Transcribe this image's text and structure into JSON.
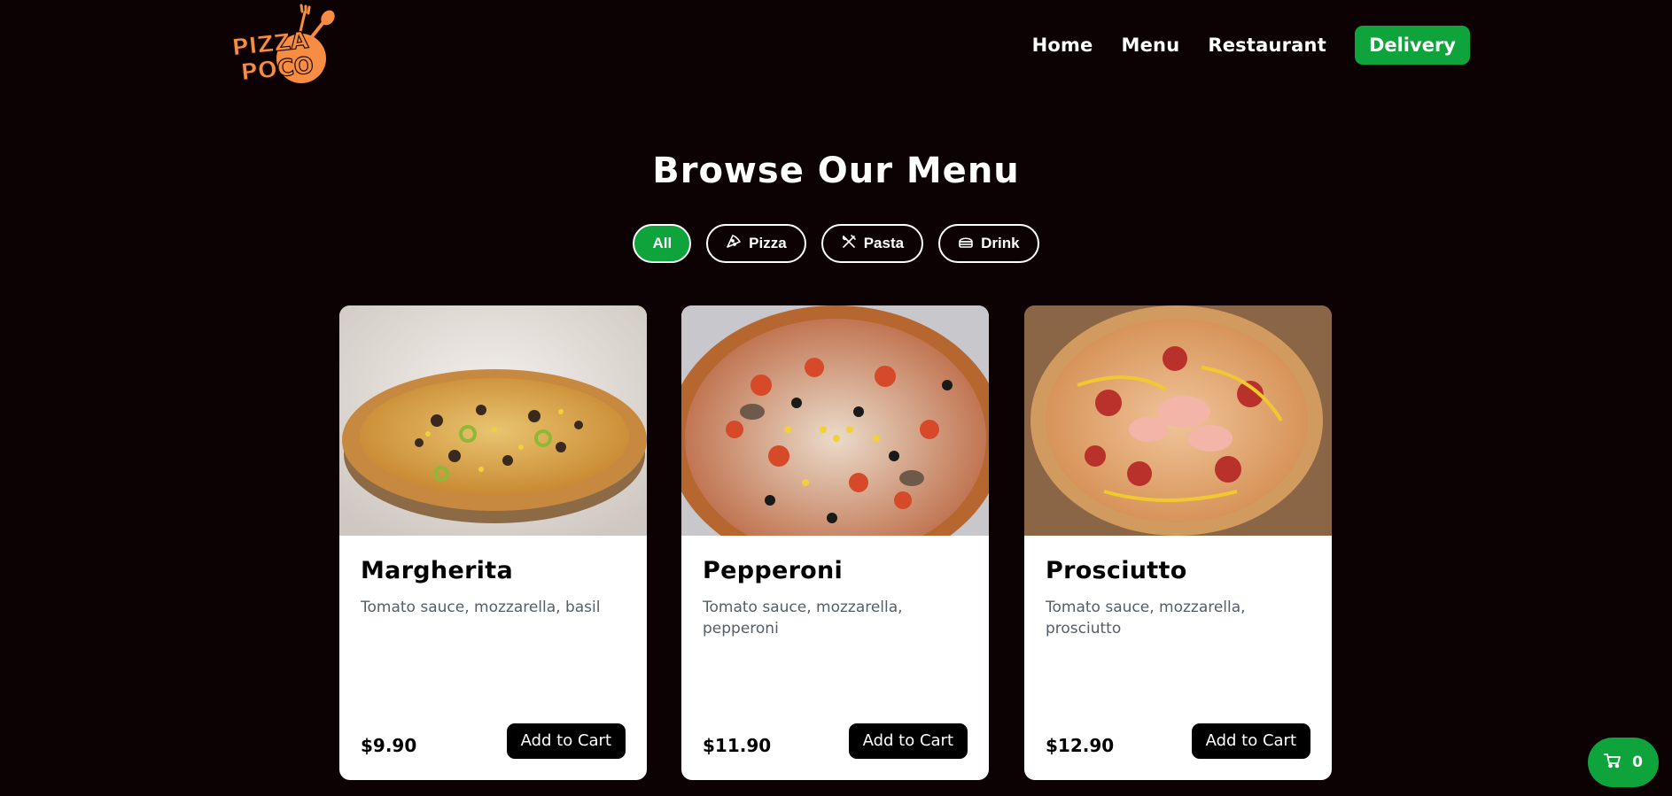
{
  "brand": {
    "logo_text_line1": "PIZZA",
    "logo_text_line2": "POCO",
    "logo_color": "#f68d42"
  },
  "nav": {
    "links": [
      {
        "label": "Home"
      },
      {
        "label": "Menu"
      },
      {
        "label": "Restaurant"
      }
    ],
    "cta_label": "Delivery"
  },
  "page": {
    "title": "Browse Our Menu"
  },
  "filters": [
    {
      "label": "All",
      "icon": null,
      "active": true
    },
    {
      "label": "Pizza",
      "icon": "pizza-slice-icon",
      "active": false
    },
    {
      "label": "Pasta",
      "icon": "fork-knife-icon",
      "active": false
    },
    {
      "label": "Drink",
      "icon": "drink-icon",
      "active": false
    }
  ],
  "products": [
    {
      "name": "Margherita",
      "description": "Tomato sauce, mozzarella, basil",
      "price": "$9.90",
      "button_label": "Add to Cart"
    },
    {
      "name": "Pepperoni",
      "description": "Tomato sauce, mozzarella, pepperoni",
      "price": "$11.90",
      "button_label": "Add to Cart"
    },
    {
      "name": "Prosciutto",
      "description": "Tomato sauce, mozzarella, prosciutto",
      "price": "$12.90",
      "button_label": "Add to Cart"
    }
  ],
  "cart": {
    "count": "0",
    "icon": "cart-icon"
  },
  "colors": {
    "background": "#0d0203",
    "accent": "#0fa33c",
    "card": "#ffffff",
    "text_muted": "#555d66"
  }
}
